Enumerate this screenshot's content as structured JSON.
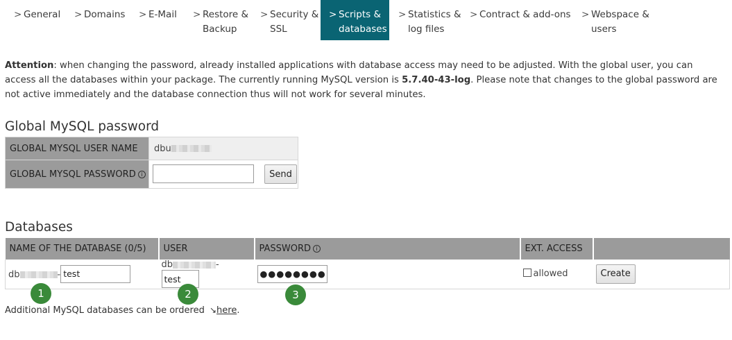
{
  "nav": {
    "tabs": [
      {
        "line1": "General",
        "line2": ""
      },
      {
        "line1": "Domains",
        "line2": ""
      },
      {
        "line1": "E-Mail",
        "line2": ""
      },
      {
        "line1": "Restore &",
        "line2": "Backup"
      },
      {
        "line1": "Security &",
        "line2": "SSL"
      },
      {
        "line1": "Scripts &",
        "line2": "databases"
      },
      {
        "line1": "Statistics &",
        "line2": "log files"
      },
      {
        "line1": "Contract & add-ons",
        "line2": ""
      },
      {
        "line1": "Webspace &",
        "line2": "users"
      }
    ],
    "chevron": ">"
  },
  "attention": {
    "label": "Attention",
    "text1": ": when changing the password, already installed applications with database access may need to be adjusted. With the global user, you can access all the databases within your package. The currently running MySQL version is ",
    "version": "5.7.40-43-log",
    "text2": ". Please note that changes to the global password are not active immediately and the database connection thus will not work for several minutes."
  },
  "global": {
    "title": "Global MySQL password",
    "user_label": "GLOBAL MYSQL USER NAME",
    "user_value": "dbu",
    "password_label": "GLOBAL MYSQL PASSWORD",
    "password_value": "",
    "send_label": "Send"
  },
  "databases": {
    "title": "Databases",
    "headers": {
      "name": "NAME OF THE DATABASE (0/5)",
      "user": "USER",
      "password": "PASSWORD",
      "ext": "EXT. ACCESS"
    },
    "row": {
      "name_prefix": "db",
      "name_sep": "-",
      "name_value": "test",
      "user_prefix": "db",
      "user_sep": "-",
      "user_value": "test",
      "password_value": "●●●●●●●●",
      "ext_label": "allowed",
      "create_label": "Create"
    }
  },
  "markers": [
    "1",
    "2",
    "3"
  ],
  "footer": {
    "text": "Additional MySQL databases can be ordered ",
    "arrow": "↘",
    "link": "here",
    "end": "."
  }
}
